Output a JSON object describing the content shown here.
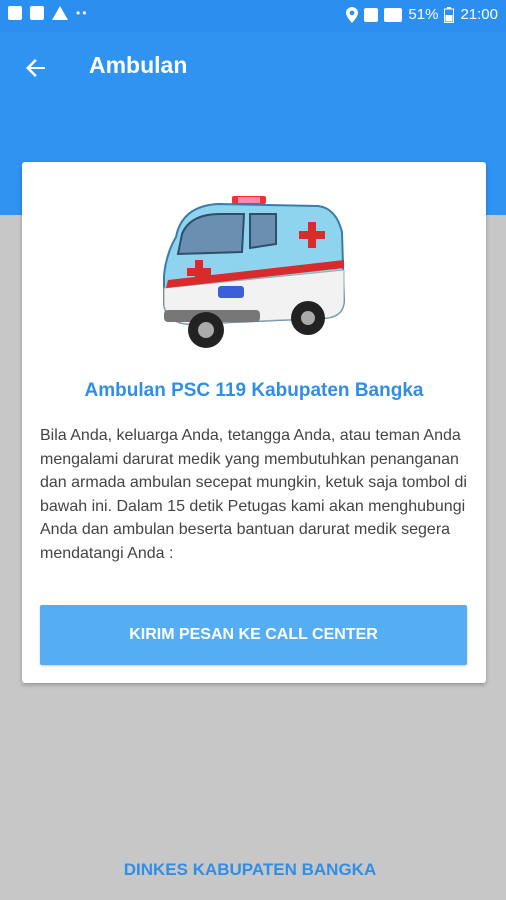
{
  "status_bar": {
    "battery": "51%",
    "time": "21:00",
    "icons": [
      "image-icon",
      "notification-icon",
      "warning-icon",
      "location-icon",
      "sim-icon",
      "signal-icon",
      "battery-icon"
    ]
  },
  "app_bar": {
    "title": "Ambulan",
    "back_icon": "arrow-left-icon"
  },
  "card": {
    "image": "ambulance-illustration",
    "title": "Ambulan PSC 119 Kabupaten Bangka",
    "body": "Bila Anda, keluarga Anda, tetangga Anda, atau teman Anda mengalami darurat medik yang membutuhkan penanganan dan armada ambulan secepat mungkin, ketuk saja tombol di bawah ini. Dalam 15 detik Petugas kami akan menghubungi Anda dan ambulan beserta bantuan darurat medik segera mendatangi Anda :",
    "button_label": "KIRIM PESAN KE CALL CENTER"
  },
  "footer": {
    "link_label": "DINKES KABUPATEN BANGKA"
  },
  "colors": {
    "primary": "#2f93f2",
    "button": "#55aef3",
    "accent_text": "#2f8ee8",
    "background": "#c7c7c7"
  }
}
